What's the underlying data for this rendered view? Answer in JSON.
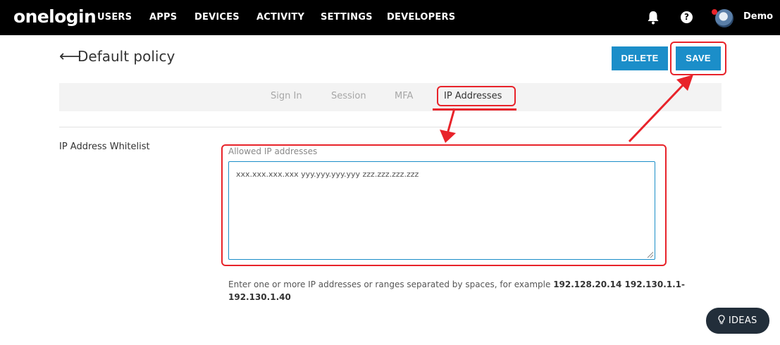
{
  "brand": {
    "logo_text": "onelogin"
  },
  "nav": {
    "items": [
      "USERS",
      "APPS",
      "DEVICES",
      "ACTIVITY",
      "SETTINGS",
      "DEVELOPERS"
    ],
    "help_glyph": "?",
    "user_name": "Demo"
  },
  "header": {
    "back_glyph": "⟵",
    "title": "Default policy",
    "delete_label": "DELETE",
    "save_label": "SAVE"
  },
  "tabs": [
    "Sign In",
    "Session",
    "MFA",
    "IP Addresses"
  ],
  "active_tab": "IP Addresses",
  "form": {
    "section_label": "IP Address Whitelist",
    "field_label": "Allowed IP addresses",
    "field_value": "xxx.xxx.xxx.xxx yyy.yyy.yyy.yyy zzz.zzz.zzz.zzz",
    "help_prefix": "Enter one or more IP addresses or ranges separated by spaces, for example ",
    "help_example": "192.128.20.14 192.130.1.1-192.130.1.40"
  },
  "ideas": {
    "label": "IDEAS"
  },
  "colors": {
    "nav_bg": "#000000",
    "accent": "#1b8ec9",
    "highlight": "#e8232a",
    "tabbar_bg": "#f3f3f3"
  },
  "icons": {
    "bell": "bell-icon",
    "help": "help-icon",
    "back": "back-arrow-icon",
    "ideas": "lightbulb-icon"
  }
}
